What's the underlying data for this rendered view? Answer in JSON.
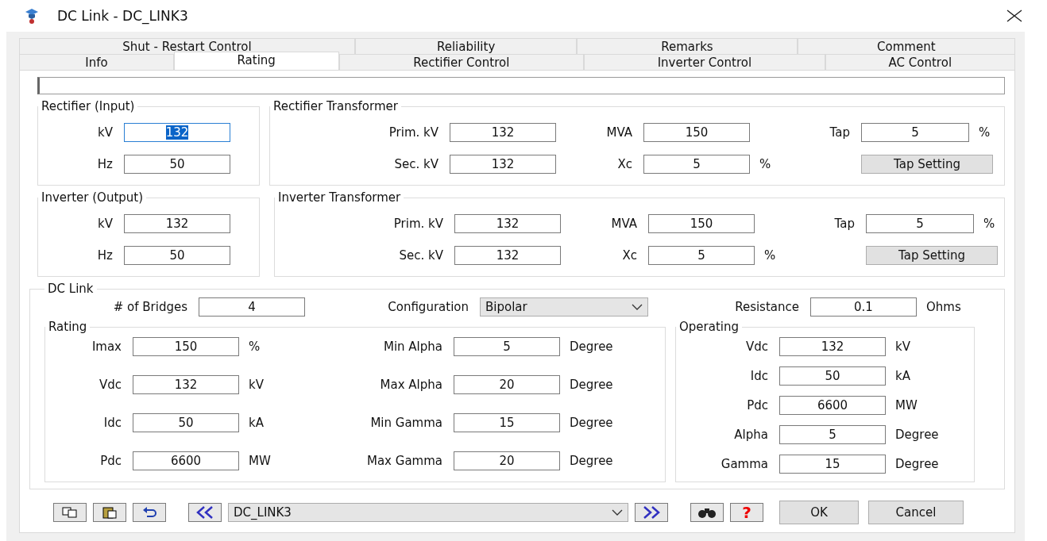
{
  "window": {
    "title": "DC Link - DC_LINK3"
  },
  "tabs": [
    [
      {
        "label": "Shut - Restart Control",
        "selected": false
      },
      {
        "label": "Reliability",
        "selected": false
      },
      {
        "label": "Remarks",
        "selected": false
      },
      {
        "label": "Comment",
        "selected": false
      }
    ],
    [
      {
        "label": "Info",
        "selected": false
      },
      {
        "label": "Rating",
        "selected": true
      },
      {
        "label": "Rectifier Control",
        "selected": false
      },
      {
        "label": "Inverter Control",
        "selected": false
      },
      {
        "label": "AC Control",
        "selected": false
      }
    ]
  ],
  "rectifier_input": {
    "title": "Rectifier (Input)",
    "fields": [
      {
        "label": "kV",
        "value": "132",
        "focused": true
      },
      {
        "label": "Hz",
        "value": "50",
        "focused": false
      }
    ]
  },
  "rectifier_transformer": {
    "title": "Rectifier Transformer",
    "fields": [
      {
        "label": "Prim. kV",
        "value": "132"
      },
      {
        "label": "MVA",
        "value": "150"
      },
      {
        "label": "Tap",
        "value": "5",
        "unit": "%"
      },
      {
        "label": "Sec. kV",
        "value": "132"
      },
      {
        "label": "Xc",
        "value": "5",
        "unit": "%"
      }
    ],
    "button": "Tap Setting"
  },
  "inverter_output": {
    "title": "Inverter (Output)",
    "fields": [
      {
        "label": "kV",
        "value": "132",
        "focused": false
      },
      {
        "label": "Hz",
        "value": "50",
        "focused": false
      }
    ]
  },
  "inverter_transformer": {
    "title": "Inverter Transformer",
    "fields": [
      {
        "label": "Prim. kV",
        "value": "132"
      },
      {
        "label": "MVA",
        "value": "150"
      },
      {
        "label": "Tap",
        "value": "5",
        "unit": "%"
      },
      {
        "label": "Sec. kV",
        "value": "132"
      },
      {
        "label": "Xc",
        "value": "5",
        "unit": "%"
      }
    ],
    "button": "Tap Setting"
  },
  "dc_link": {
    "title": "DC Link",
    "bridges": {
      "label": "# of Bridges",
      "value": "4"
    },
    "configuration": {
      "label": "Configuration",
      "value": "Bipolar"
    },
    "resistance": {
      "label": "Resistance",
      "value": "0.1",
      "unit": "Ohms"
    },
    "rating": {
      "title": "Rating",
      "fields": [
        {
          "label": "Imax",
          "value": "150",
          "unit": "%"
        },
        {
          "label": "Vdc",
          "value": "132",
          "unit": "kV"
        },
        {
          "label": "Idc",
          "value": "50",
          "unit": "kA"
        },
        {
          "label": "Pdc",
          "value": "6600",
          "unit": "MW"
        }
      ]
    },
    "limits": [
      {
        "label": "Min Alpha",
        "value": "5",
        "unit": "Degree"
      },
      {
        "label": "Max Alpha",
        "value": "20",
        "unit": "Degree"
      },
      {
        "label": "Min Gamma",
        "value": "15",
        "unit": "Degree"
      },
      {
        "label": "Max Gamma",
        "value": "20",
        "unit": "Degree"
      }
    ],
    "operating": {
      "title": "Operating",
      "fields": [
        {
          "label": "Vdc",
          "value": "132",
          "unit": "kV"
        },
        {
          "label": "Idc",
          "value": "50",
          "unit": "kA"
        },
        {
          "label": "Pdc",
          "value": "6600",
          "unit": "MW"
        },
        {
          "label": "Alpha",
          "value": "5",
          "unit": "Degree"
        },
        {
          "label": "Gamma",
          "value": "15",
          "unit": "Degree"
        }
      ]
    }
  },
  "footer": {
    "record": "DC_LINK3",
    "help": "?",
    "buttons": [
      "OK",
      "Cancel"
    ]
  }
}
